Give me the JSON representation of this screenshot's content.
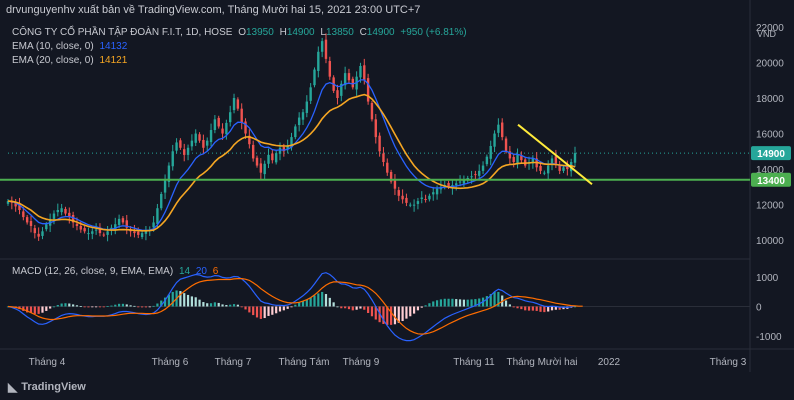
{
  "header": "drvunguyenhv xuất bản về TradingView.com, Tháng Mười hai 15, 2021 23:00 UTC+7",
  "legend": {
    "symbol": "CÔNG TY CỔ PHẦN TẬP ĐOÀN F.I.T, 1D, HOSE",
    "o_label": "O",
    "o": "13950",
    "h_label": "H",
    "h": "14900",
    "l_label": "L",
    "l": "13850",
    "c_label": "C",
    "c": "14900",
    "change": "+950 (+6.81%)",
    "ema10_label": "EMA (10, close, 0)",
    "ema10": "14132",
    "ema20_label": "EMA (20, close, 0)",
    "ema20": "14121",
    "macd_label": "MACD (12, 26, close, 9, EMA, EMA)",
    "macd_a": "14",
    "macd_b": "20",
    "macd_c": "6"
  },
  "currency": "VND",
  "price_badge": "14900",
  "support_badge": "13400",
  "footer": "TradingView",
  "colors": {
    "up": "#26a69a",
    "down": "#ef5350",
    "ema10": "#2962ff",
    "ema20": "#f5a623",
    "support": "#4caf50",
    "trend": "#ffeb3b",
    "macd": "#2962ff",
    "signal": "#ff6d00"
  },
  "chart_data": {
    "type": "line",
    "x_ticks": [
      "Tháng 4",
      "Tháng 6",
      "Tháng 7",
      "Tháng Tám",
      "Tháng 9",
      "Tháng 11",
      "Tháng Mười hai",
      "2022",
      "Tháng 3"
    ],
    "price_axis": [
      22000,
      20000,
      18000,
      16000,
      14000,
      12000,
      10000
    ],
    "price_ylim": [
      9000,
      22500
    ],
    "macd_axis": [
      1000,
      0,
      -1000
    ],
    "macd_ylim": [
      -1400,
      1500
    ],
    "support_level": 13400,
    "last_price": 14900,
    "close": [
      12200,
      12100,
      11900,
      11700,
      11300,
      11000,
      10800,
      10400,
      10200,
      10500,
      10900,
      11200,
      11500,
      11700,
      11800,
      11500,
      11300,
      11000,
      10800,
      10600,
      10500,
      10400,
      10500,
      10600,
      10400,
      10300,
      10500,
      10700,
      10900,
      11200,
      11000,
      10700,
      10500,
      10400,
      10300,
      10400,
      10500,
      10600,
      11000,
      11800,
      12600,
      13400,
      14200,
      15000,
      15500,
      15200,
      14800,
      15200,
      15600,
      16000,
      15600,
      15200,
      15600,
      16200,
      16800,
      16400,
      16000,
      16600,
      17200,
      18000,
      17400,
      16600,
      16000,
      15400,
      14600,
      14200,
      13800,
      14300,
      14800,
      14500,
      14900,
      15200,
      15000,
      15300,
      15800,
      16400,
      16900,
      17200,
      17800,
      18600,
      19600,
      20600,
      21200,
      20200,
      19200,
      18400,
      18000,
      18800,
      19400,
      19000,
      18600,
      19200,
      19800,
      19000,
      17800,
      16800,
      15800,
      15000,
      14400,
      13800,
      13300,
      12900,
      12500,
      12300,
      12100,
      12000,
      12000,
      12200,
      12400,
      12300,
      12500,
      12700,
      12900,
      13000,
      13100,
      13000,
      13100,
      13200,
      13300,
      13400,
      13500,
      13600,
      13700,
      13900,
      14200,
      14700,
      15300,
      16000,
      16500,
      15800,
      15000,
      14600,
      14400,
      14800,
      14500,
      14200,
      14400,
      14600,
      14100,
      13900,
      13800,
      14200,
      14600,
      14300,
      13900,
      14100,
      14000,
      14400,
      14900
    ],
    "ema10": [
      12200,
      12180,
      12100,
      11980,
      11800,
      11600,
      11420,
      11200,
      11000,
      10930,
      10930,
      10980,
      11070,
      11180,
      11290,
      11330,
      11330,
      11270,
      11180,
      11070,
      10970,
      10870,
      10800,
      10760,
      10690,
      10620,
      10600,
      10620,
      10670,
      10770,
      10810,
      10790,
      10740,
      10680,
      10610,
      10570,
      10560,
      10570,
      10650,
      10860,
      11170,
      11580,
      12060,
      12590,
      13110,
      13490,
      13730,
      13990,
      14290,
      14600,
      14780,
      14860,
      15000,
      15220,
      15510,
      15670,
      15730,
      15890,
      16130,
      16470,
      16640,
      16630,
      16520,
      16320,
      15990,
      15660,
      15320,
      15220,
      15230,
      15100,
      15060,
      15080,
      15070,
      15110,
      15240,
      15470,
      15730,
      16000,
      16330,
      16740,
      17260,
      17870,
      18460,
      18780,
      18860,
      18780,
      18640,
      18670,
      18800,
      18830,
      18790,
      18860,
      19020,
      19020,
      18800,
      18440,
      17960,
      17440,
      16880,
      16320,
      15770,
      15280,
      14870,
      14510,
      14160,
      13860,
      13620,
      13400,
      13230,
      13090,
      13000,
      12950,
      12940,
      12950,
      12980,
      13000,
      13020,
      13050,
      13090,
      13150,
      13210,
      13280,
      13360,
      13460,
      13590,
      13800,
      14070,
      14450,
      14830,
      15000,
      15000,
      14930,
      14840,
      14830,
      14770,
      14670,
      14620,
      14620,
      14530,
      14410,
      14300,
      14280,
      14310,
      14290,
      14200,
      14180,
      14150,
      14200,
      14132
    ],
    "ema20": [
      12200,
      12190,
      12140,
      12070,
      11950,
      11820,
      11690,
      11520,
      11350,
      11250,
      11180,
      11140,
      11130,
      11150,
      11170,
      11170,
      11150,
      11090,
      11020,
      10930,
      10850,
      10770,
      10720,
      10680,
      10640,
      10600,
      10580,
      10570,
      10570,
      10590,
      10600,
      10590,
      10580,
      10560,
      10540,
      10530,
      10530,
      10540,
      10570,
      10690,
      10870,
      11100,
      11380,
      11720,
      12080,
      12380,
      12620,
      12870,
      13130,
      13400,
      13610,
      13760,
      13940,
      14160,
      14420,
      14620,
      14750,
      14910,
      15100,
      15370,
      15570,
      15710,
      15800,
      15820,
      15740,
      15640,
      15520,
      15460,
      15420,
      15370,
      15330,
      15310,
      15300,
      15300,
      15340,
      15420,
      15510,
      15630,
      15790,
      15990,
      16230,
      16510,
      16830,
      17080,
      17280,
      17400,
      17480,
      17610,
      17770,
      17930,
      18010,
      18070,
      18140,
      18190,
      18120,
      17940,
      17690,
      17410,
      17090,
      16730,
      16350,
      15960,
      15570,
      15190,
      14830,
      14500,
      14200,
      13960,
      13760,
      13590,
      13440,
      13310,
      13200,
      13110,
      13050,
      12990,
      12950,
      12930,
      12920,
      12930,
      12950,
      12990,
      13040,
      13100,
      13190,
      13330,
      13510,
      13740,
      13990,
      14140,
      14220,
      14260,
      14270,
      14310,
      14330,
      14340,
      14350,
      14370,
      14370,
      14330,
      14280,
      14270,
      14270,
      14260,
      14230,
      14210,
      14190,
      14190,
      14121
    ],
    "macd_values": [
      0,
      -30,
      -80,
      -150,
      -250,
      -350,
      -430,
      -520,
      -590,
      -600,
      -570,
      -510,
      -440,
      -370,
      -300,
      -260,
      -240,
      -250,
      -270,
      -300,
      -320,
      -340,
      -340,
      -330,
      -330,
      -330,
      -310,
      -280,
      -240,
      -190,
      -170,
      -170,
      -190,
      -210,
      -240,
      -260,
      -270,
      -260,
      -220,
      -120,
      30,
      210,
      410,
      620,
      810,
      920,
      960,
      1000,
      1040,
      1080,
      1060,
      1010,
      990,
      1000,
      1040,
      1030,
      980,
      960,
      970,
      1010,
      1000,
      930,
      820,
      680,
      510,
      340,
      180,
      120,
      100,
      60,
      40,
      40,
      30,
      50,
      100,
      180,
      270,
      360,
      470,
      600,
      760,
      940,
      1110,
      1140,
      1080,
      970,
      830,
      760,
      750,
      700,
      630,
      620,
      650,
      580,
      420,
      220,
      0,
      -230,
      -450,
      -650,
      -820,
      -960,
      -1060,
      -1120,
      -1150,
      -1150,
      -1120,
      -1050,
      -970,
      -880,
      -780,
      -680,
      -580,
      -490,
      -400,
      -330,
      -270,
      -220,
      -170,
      -120,
      -70,
      -20,
      30,
      90,
      160,
      250,
      370,
      500,
      580,
      540,
      450,
      370,
      300,
      280,
      240,
      190,
      160,
      140,
      100,
      50,
      10,
      0,
      10,
      0,
      -20,
      -20,
      -30,
      -10,
      20
    ],
    "signal_values": [
      0,
      -10,
      -30,
      -60,
      -100,
      -150,
      -210,
      -270,
      -340,
      -390,
      -420,
      -440,
      -440,
      -420,
      -400,
      -370,
      -340,
      -320,
      -310,
      -310,
      -310,
      -310,
      -320,
      -320,
      -320,
      -320,
      -320,
      -310,
      -300,
      -280,
      -260,
      -240,
      -230,
      -230,
      -230,
      -230,
      -240,
      -240,
      -240,
      -220,
      -170,
      -90,
      10,
      130,
      270,
      400,
      510,
      610,
      700,
      770,
      830,
      860,
      880,
      890,
      900,
      910,
      910,
      910,
      910,
      930,
      940,
      940,
      920,
      880,
      800,
      710,
      600,
      510,
      420,
      340,
      270,
      210,
      160,
      130,
      120,
      120,
      140,
      180,
      230,
      300,
      390,
      500,
      620,
      720,
      790,
      830,
      830,
      820,
      810,
      790,
      760,
      730,
      720,
      690,
      640,
      550,
      440,
      300,
      140,
      -30,
      -200,
      -360,
      -510,
      -630,
      -740,
      -820,
      -880,
      -920,
      -930,
      -920,
      -890,
      -850,
      -790,
      -730,
      -660,
      -590,
      -530,
      -470,
      -410,
      -350,
      -300,
      -260,
      -220,
      -180,
      -140,
      -100,
      -50,
      10,
      90,
      170,
      250,
      300,
      330,
      340,
      330,
      320,
      300,
      280,
      250,
      230,
      200,
      170,
      140,
      110,
      90,
      70,
      50,
      30,
      20,
      10,
      10
    ]
  }
}
